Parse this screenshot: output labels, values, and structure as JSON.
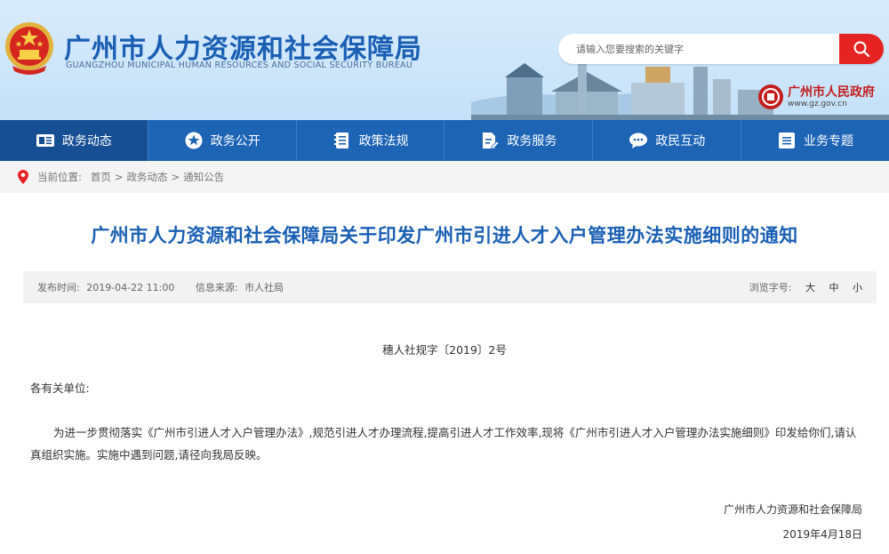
{
  "header": {
    "title_cn": "广州市人力资源和社会保障局",
    "title_en": "GUANGZHOU MUNICIPAL HUMAN RESOURCES AND SOCIAL SECURITY BUREAU",
    "search_placeholder": "请输入您要搜索的关键字",
    "gov_name": "广州市人民政府",
    "gov_url": "www.gz.gov.cn"
  },
  "nav": {
    "items": [
      {
        "label": "政务动态",
        "icon": "news-icon"
      },
      {
        "label": "政务公开",
        "icon": "star-icon"
      },
      {
        "label": "政策法规",
        "icon": "book-icon"
      },
      {
        "label": "政务服务",
        "icon": "document-edit-icon"
      },
      {
        "label": "政民互动",
        "icon": "chat-icon"
      },
      {
        "label": "业务专题",
        "icon": "list-icon"
      }
    ]
  },
  "breadcrumb": {
    "prefix": "当前位置:",
    "home": "首页",
    "sep": ">",
    "level1": "政务动态",
    "level2": "通知公告"
  },
  "article": {
    "title": "广州市人力资源和社会保障局关于印发广州市引进人才入户管理办法实施细则的通知",
    "meta": {
      "time_label": "发布时间:",
      "time_value": "2019-04-22 11:00",
      "source_label": "信息来源:",
      "source_value": "市人社局",
      "fontsize_label": "浏览字号:",
      "size_large": "大",
      "size_medium": "中",
      "size_small": "小"
    },
    "doc_number": "穗人社规字〔2019〕2号",
    "salutation": "各有关单位:",
    "body": "为进一步贯彻落实《广州市引进人才入户管理办法》,规范引进人才办理流程,提高引进人才工作效率,现将《广州市引进人才入户管理办法实施细则》印发给你们,请认真组织实施。实施中遇到问题,请径向我局反映。",
    "signature_org": "广州市人力资源和社会保障局",
    "signature_date": "2019年4月18日"
  },
  "colors": {
    "brand_blue": "#1a5fb4",
    "nav_blue": "#1d64b5",
    "search_red": "#e52322",
    "gov_red": "#c41e1e"
  }
}
